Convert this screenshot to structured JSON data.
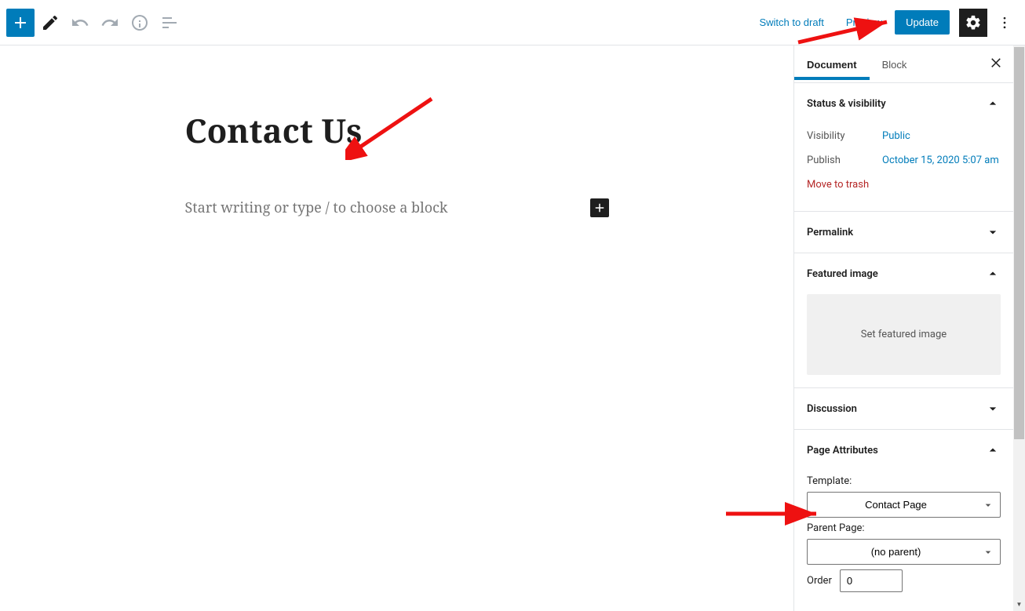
{
  "toolbar": {
    "switch_draft": "Switch to draft",
    "preview": "Preview",
    "update": "Update"
  },
  "editor": {
    "title": "Contact Us",
    "body_placeholder": "Start writing or type / to choose a block"
  },
  "sidebar": {
    "tabs": {
      "document": "Document",
      "block": "Block"
    },
    "status": {
      "heading": "Status & visibility",
      "visibility_label": "Visibility",
      "visibility_value": "Public",
      "publish_label": "Publish",
      "publish_value": "October 15, 2020 5:07 am",
      "trash": "Move to trash"
    },
    "permalink": {
      "heading": "Permalink"
    },
    "featured": {
      "heading": "Featured image",
      "cta": "Set featured image"
    },
    "discussion": {
      "heading": "Discussion"
    },
    "attrs": {
      "heading": "Page Attributes",
      "template_label": "Template:",
      "template_value": "Contact Page",
      "parent_label": "Parent Page:",
      "parent_value": "(no parent)",
      "order_label": "Order",
      "order_value": "0"
    }
  }
}
